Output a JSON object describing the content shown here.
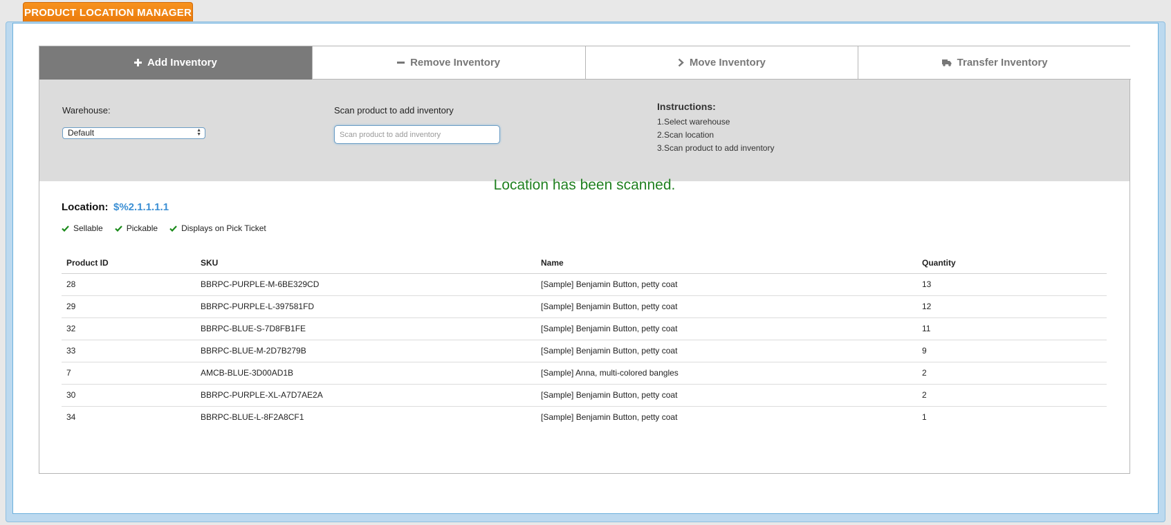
{
  "app": {
    "title": "PRODUCT LOCATION MANAGER"
  },
  "tabs": [
    {
      "label": "Add Inventory",
      "icon": "plus-icon",
      "active": true
    },
    {
      "label": "Remove Inventory",
      "icon": "minus-icon",
      "active": false
    },
    {
      "label": "Move Inventory",
      "icon": "chevron-right-icon",
      "active": false
    },
    {
      "label": "Transfer Inventory",
      "icon": "truck-icon",
      "active": false
    }
  ],
  "form": {
    "warehouse_label": "Warehouse:",
    "warehouse_value": "Default",
    "scan_label": "Scan product to add inventory",
    "scan_placeholder": "Scan product to add inventory",
    "scan_value": ""
  },
  "instructions": {
    "title": "Instructions:",
    "steps": [
      "1.Select warehouse",
      "2.Scan location",
      "3.Scan product to add inventory"
    ]
  },
  "status": {
    "message": "Location has been scanned."
  },
  "location": {
    "label": "Location:",
    "value": "$%2.1.1.1.1",
    "flags": [
      "Sellable",
      "Pickable",
      "Displays on Pick Ticket"
    ]
  },
  "table": {
    "columns": [
      "Product ID",
      "SKU",
      "Name",
      "Quantity"
    ],
    "rows": [
      [
        "28",
        "BBRPC-PURPLE-M-6BE329CD",
        "[Sample] Benjamin Button, petty coat",
        "13"
      ],
      [
        "29",
        "BBRPC-PURPLE-L-397581FD",
        "[Sample] Benjamin Button, petty coat",
        "12"
      ],
      [
        "32",
        "BBRPC-BLUE-S-7D8FB1FE",
        "[Sample] Benjamin Button, petty coat",
        "11"
      ],
      [
        "33",
        "BBRPC-BLUE-M-2D7B279B",
        "[Sample] Benjamin Button, petty coat",
        "9"
      ],
      [
        "7",
        "AMCB-BLUE-3D00AD1B",
        "[Sample] Anna, multi-colored bangles",
        "2"
      ],
      [
        "30",
        "BBRPC-PURPLE-XL-A7D7AE2A",
        "[Sample] Benjamin Button, petty coat",
        "2"
      ],
      [
        "34",
        "BBRPC-BLUE-L-8F2A8CF1",
        "[Sample] Benjamin Button, petty coat",
        "1"
      ]
    ]
  },
  "colors": {
    "accent": "#f7921e",
    "active_tab": "#7a7a7a",
    "success": "#208020",
    "link": "#3b8fd4",
    "check": "#1a8a1a"
  }
}
